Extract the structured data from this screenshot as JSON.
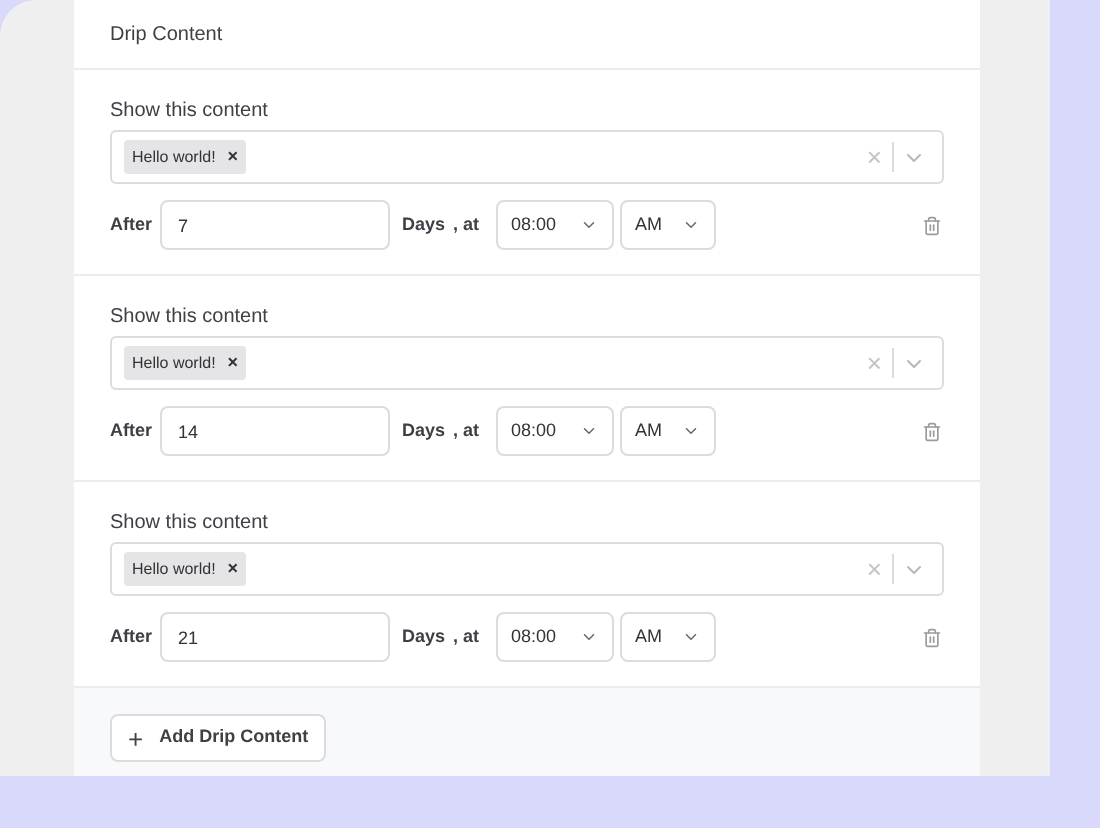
{
  "panel": {
    "title": "Drip Content"
  },
  "items": [
    {
      "label": "Show this content",
      "tags": [
        {
          "text": "Hello world!",
          "remove": "×"
        }
      ],
      "clear": "×",
      "after_label": "After",
      "days": "7",
      "days_label": "Days",
      "at_label": ", at",
      "time": "08:00",
      "meridiem": "AM"
    },
    {
      "label": "Show this content",
      "tags": [
        {
          "text": "Hello world!",
          "remove": "×"
        }
      ],
      "clear": "×",
      "after_label": "After",
      "days": "14",
      "days_label": "Days",
      "at_label": ", at",
      "time": "08:00",
      "meridiem": "AM"
    },
    {
      "label": "Show this content",
      "tags": [
        {
          "text": "Hello world!",
          "remove": "×"
        }
      ],
      "clear": "×",
      "after_label": "After",
      "days": "21",
      "days_label": "Days",
      "at_label": ", at",
      "time": "08:00",
      "meridiem": "AM"
    }
  ],
  "add_button": {
    "icon": "+",
    "label": "Add Drip Content"
  }
}
